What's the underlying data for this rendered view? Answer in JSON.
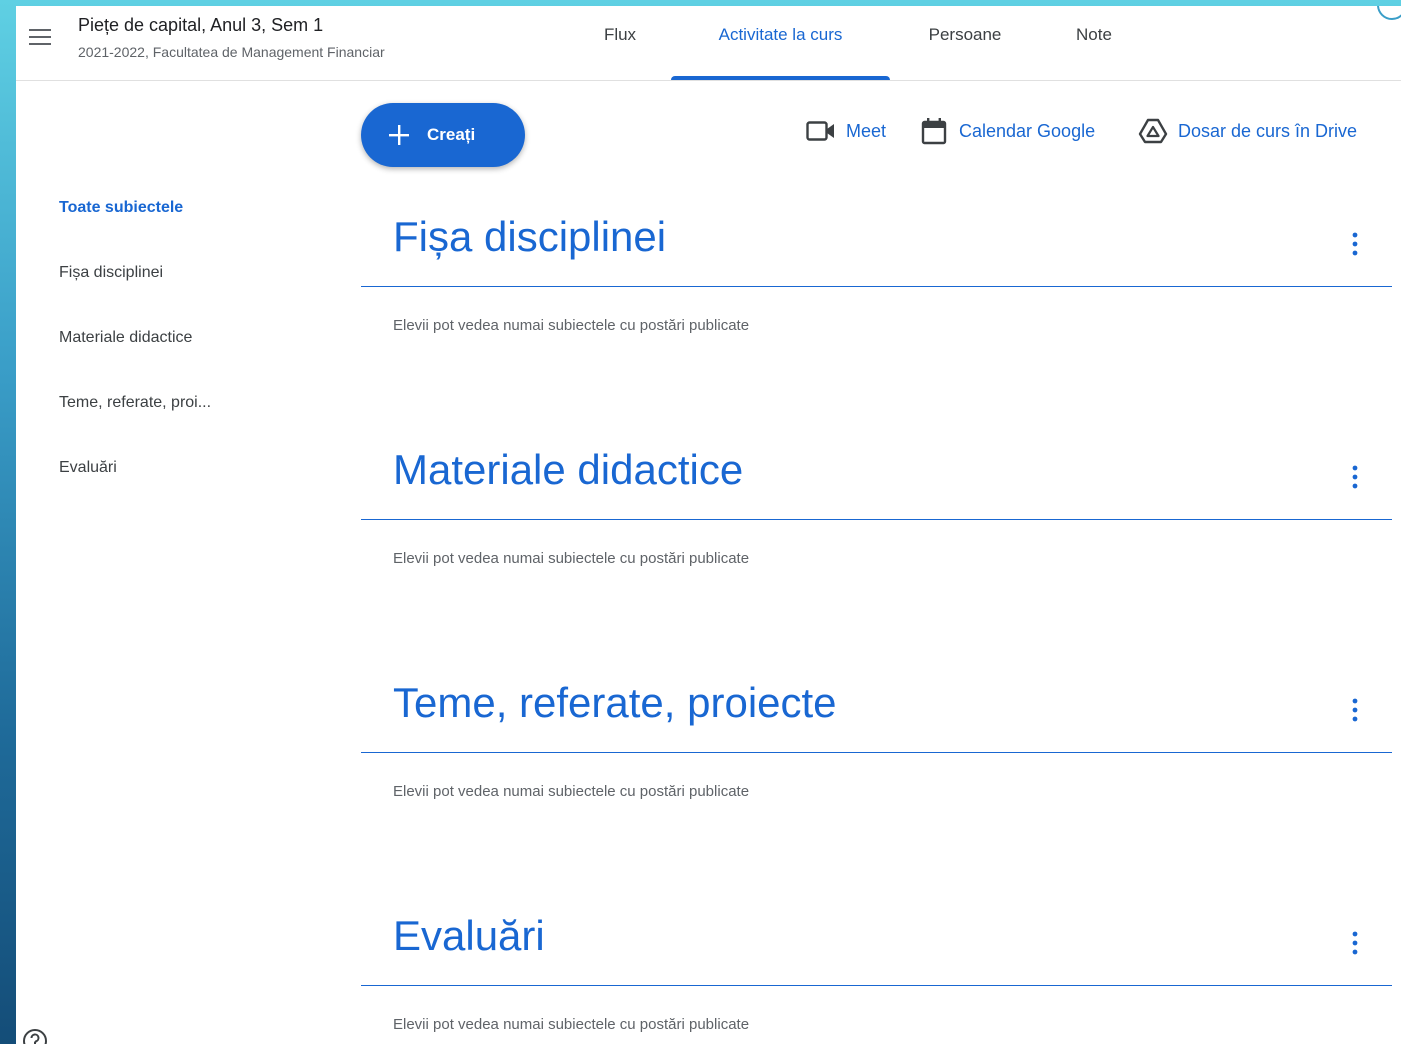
{
  "header": {
    "class_title": "Piețe de capital, Anul 3, Sem 1",
    "class_subtitle": "2021-2022, Facultatea de Management Financiar",
    "menu_icon": "menu-icon",
    "tabs": [
      {
        "label": "Flux",
        "active": false
      },
      {
        "label": "Activitate la curs",
        "active": true
      },
      {
        "label": "Persoane",
        "active": false
      },
      {
        "label": "Note",
        "active": false
      }
    ]
  },
  "toolbar": {
    "create_label": "Creați",
    "create_icon": "plus-icon",
    "links": [
      {
        "label": "Meet",
        "icon": "video-camera-icon"
      },
      {
        "label": "Calendar Google",
        "icon": "calendar-icon"
      },
      {
        "label": "Dosar de curs în Drive",
        "icon": "drive-icon"
      }
    ]
  },
  "sidebar": {
    "items": [
      {
        "label": "Toate subiectele",
        "active": true
      },
      {
        "label": "Fișa disciplinei",
        "active": false
      },
      {
        "label": "Materiale didactice",
        "active": false
      },
      {
        "label": "Teme, referate, proi...",
        "active": false
      },
      {
        "label": "Evaluări",
        "active": false
      }
    ]
  },
  "topics": [
    {
      "title": "Fișa disciplinei",
      "note": "Elevii pot vedea numai subiectele cu postări publicate"
    },
    {
      "title": "Materiale didactice",
      "note": "Elevii pot vedea numai subiectele cu postări publicate"
    },
    {
      "title": "Teme, referate, proiecte",
      "note": "Elevii pot vedea numai subiectele cu postări publicate"
    },
    {
      "title": "Evaluări",
      "note": "Elevii pot vedea numai subiectele cu postări publicate"
    }
  ],
  "colors": {
    "accent": "#1967d2",
    "text": "#3c4043",
    "muted": "#5f6368"
  }
}
